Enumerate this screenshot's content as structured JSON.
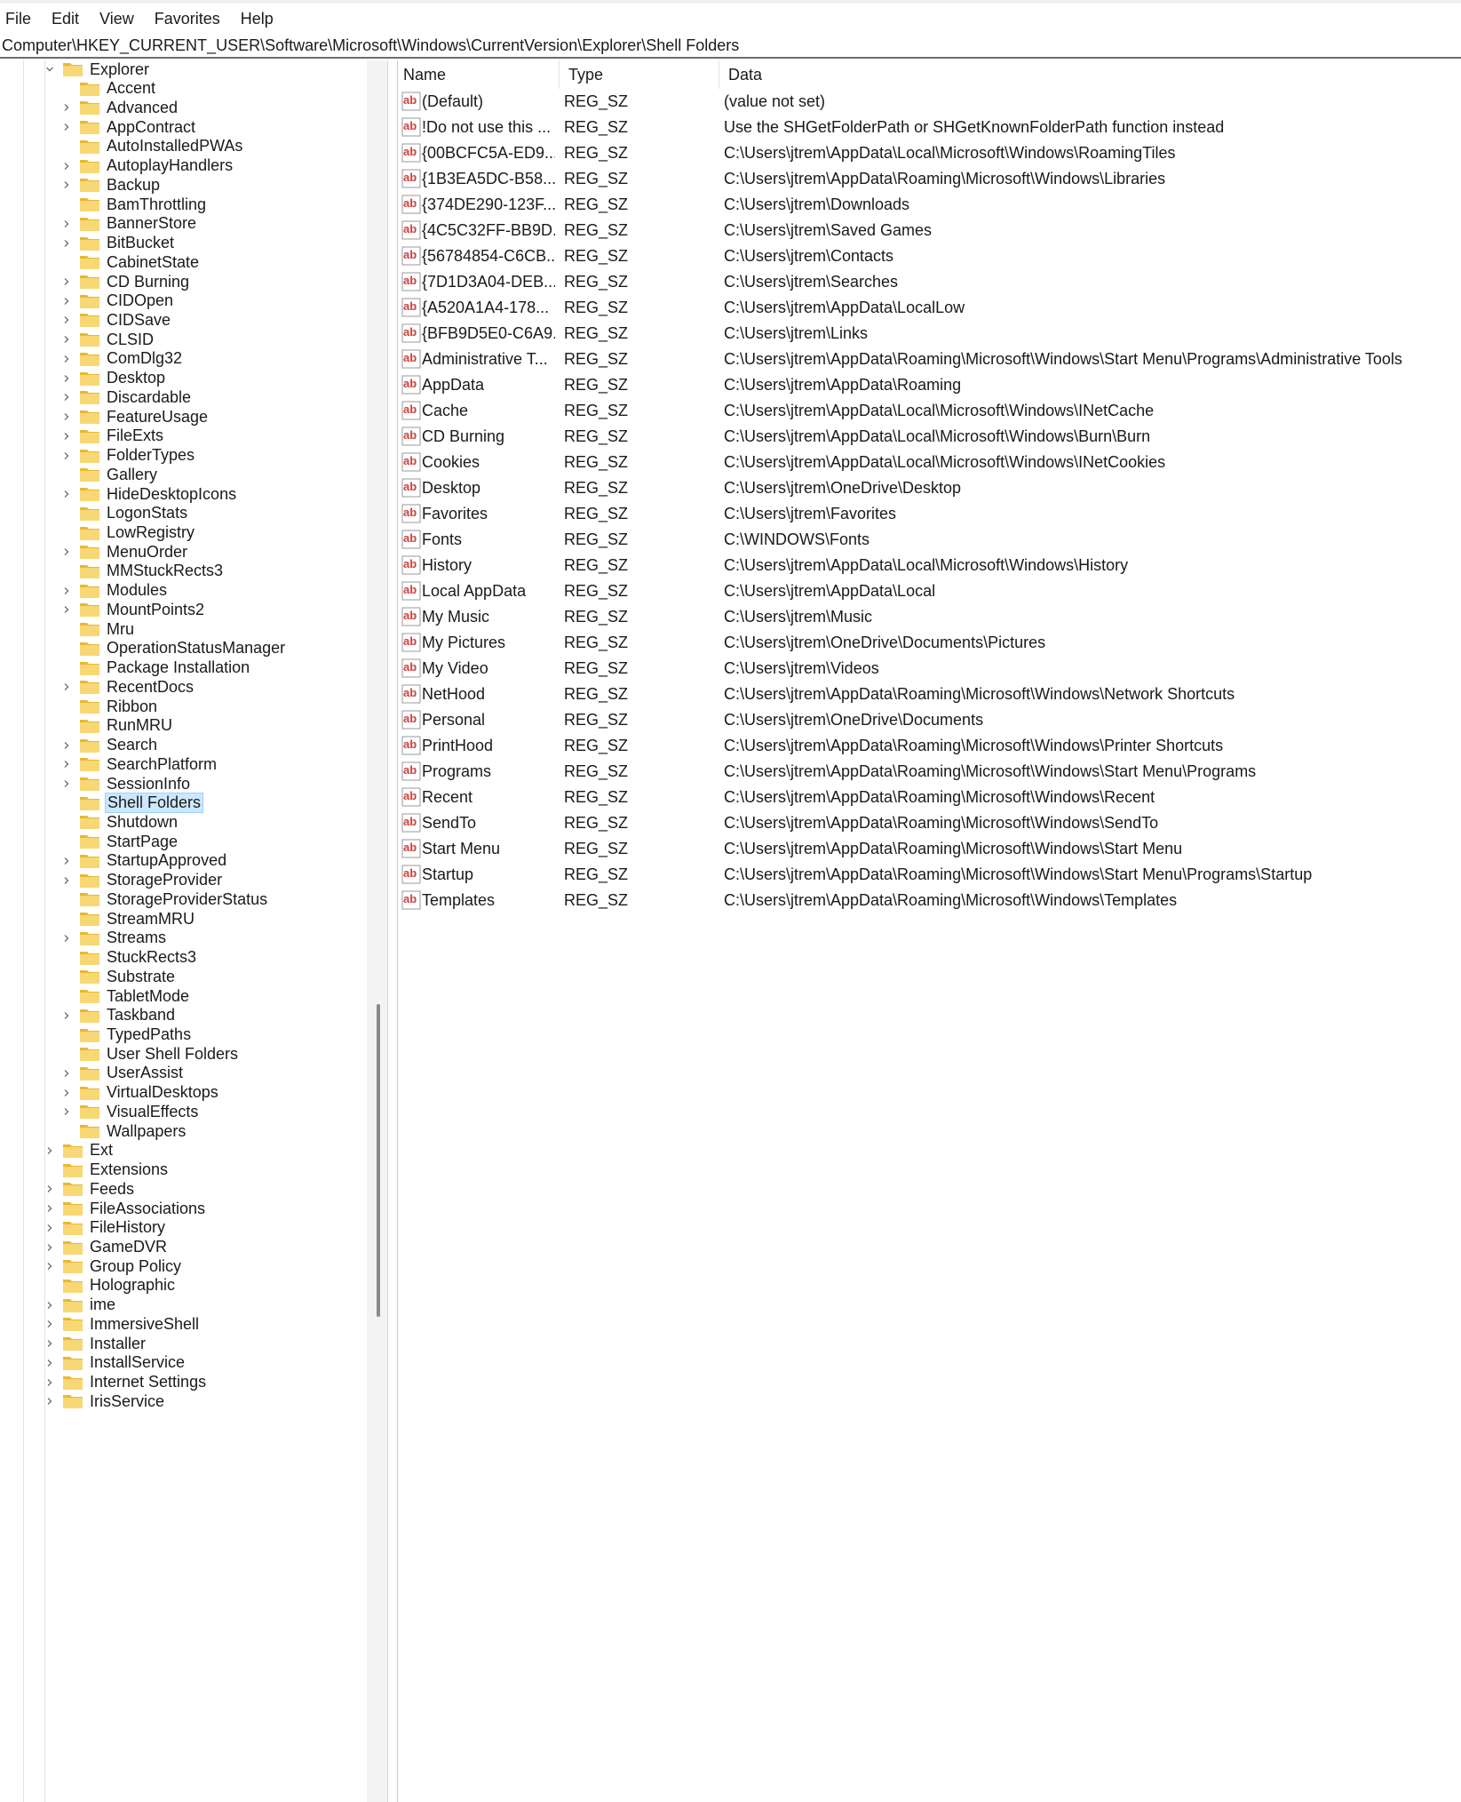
{
  "menu": [
    "File",
    "Edit",
    "View",
    "Favorites",
    "Help"
  ],
  "address": "Computer\\HKEY_CURRENT_USER\\Software\\Microsoft\\Windows\\CurrentVersion\\Explorer\\Shell Folders",
  "tree": {
    "parent": "Explorer",
    "children": [
      {
        "label": "Accent",
        "expandable": false
      },
      {
        "label": "Advanced",
        "expandable": true
      },
      {
        "label": "AppContract",
        "expandable": true
      },
      {
        "label": "AutoInstalledPWAs",
        "expandable": false
      },
      {
        "label": "AutoplayHandlers",
        "expandable": true
      },
      {
        "label": "Backup",
        "expandable": true
      },
      {
        "label": "BamThrottling",
        "expandable": false
      },
      {
        "label": "BannerStore",
        "expandable": true
      },
      {
        "label": "BitBucket",
        "expandable": true
      },
      {
        "label": "CabinetState",
        "expandable": false
      },
      {
        "label": "CD Burning",
        "expandable": true
      },
      {
        "label": "CIDOpen",
        "expandable": true
      },
      {
        "label": "CIDSave",
        "expandable": true
      },
      {
        "label": "CLSID",
        "expandable": true
      },
      {
        "label": "ComDlg32",
        "expandable": true
      },
      {
        "label": "Desktop",
        "expandable": true
      },
      {
        "label": "Discardable",
        "expandable": true
      },
      {
        "label": "FeatureUsage",
        "expandable": true
      },
      {
        "label": "FileExts",
        "expandable": true
      },
      {
        "label": "FolderTypes",
        "expandable": true
      },
      {
        "label": "Gallery",
        "expandable": false
      },
      {
        "label": "HideDesktopIcons",
        "expandable": true
      },
      {
        "label": "LogonStats",
        "expandable": false
      },
      {
        "label": "LowRegistry",
        "expandable": false
      },
      {
        "label": "MenuOrder",
        "expandable": true
      },
      {
        "label": "MMStuckRects3",
        "expandable": false
      },
      {
        "label": "Modules",
        "expandable": true
      },
      {
        "label": "MountPoints2",
        "expandable": true
      },
      {
        "label": "Mru",
        "expandable": false
      },
      {
        "label": "OperationStatusManager",
        "expandable": false
      },
      {
        "label": "Package Installation",
        "expandable": false
      },
      {
        "label": "RecentDocs",
        "expandable": true
      },
      {
        "label": "Ribbon",
        "expandable": false
      },
      {
        "label": "RunMRU",
        "expandable": false
      },
      {
        "label": "Search",
        "expandable": true
      },
      {
        "label": "SearchPlatform",
        "expandable": true
      },
      {
        "label": "SessionInfo",
        "expandable": true
      },
      {
        "label": "Shell Folders",
        "expandable": false,
        "selected": true
      },
      {
        "label": "Shutdown",
        "expandable": false
      },
      {
        "label": "StartPage",
        "expandable": false
      },
      {
        "label": "StartupApproved",
        "expandable": true
      },
      {
        "label": "StorageProvider",
        "expandable": true
      },
      {
        "label": "StorageProviderStatus",
        "expandable": false
      },
      {
        "label": "StreamMRU",
        "expandable": false
      },
      {
        "label": "Streams",
        "expandable": true
      },
      {
        "label": "StuckRects3",
        "expandable": false
      },
      {
        "label": "Substrate",
        "expandable": false
      },
      {
        "label": "TabletMode",
        "expandable": false
      },
      {
        "label": "Taskband",
        "expandable": true
      },
      {
        "label": "TypedPaths",
        "expandable": false
      },
      {
        "label": "User Shell Folders",
        "expandable": false
      },
      {
        "label": "UserAssist",
        "expandable": true
      },
      {
        "label": "VirtualDesktops",
        "expandable": true
      },
      {
        "label": "VisualEffects",
        "expandable": true
      },
      {
        "label": "Wallpapers",
        "expandable": false
      }
    ],
    "siblings": [
      {
        "label": "Ext",
        "expandable": true
      },
      {
        "label": "Extensions",
        "expandable": false
      },
      {
        "label": "Feeds",
        "expandable": true
      },
      {
        "label": "FileAssociations",
        "expandable": true
      },
      {
        "label": "FileHistory",
        "expandable": true
      },
      {
        "label": "GameDVR",
        "expandable": true
      },
      {
        "label": "Group Policy",
        "expandable": true
      },
      {
        "label": "Holographic",
        "expandable": false
      },
      {
        "label": "ime",
        "expandable": true
      },
      {
        "label": "ImmersiveShell",
        "expandable": true
      },
      {
        "label": "Installer",
        "expandable": true
      },
      {
        "label": "InstallService",
        "expandable": true
      },
      {
        "label": "Internet Settings",
        "expandable": true
      },
      {
        "label": "IrisService",
        "expandable": true
      }
    ]
  },
  "columns": {
    "name": "Name",
    "type": "Type",
    "data": "Data"
  },
  "values": [
    {
      "name": "(Default)",
      "type": "REG_SZ",
      "data": "(value not set)"
    },
    {
      "name": "!Do not use this ...",
      "type": "REG_SZ",
      "data": "Use the SHGetFolderPath or SHGetKnownFolderPath function instead"
    },
    {
      "name": "{00BCFC5A-ED9...",
      "type": "REG_SZ",
      "data": "C:\\Users\\jtrem\\AppData\\Local\\Microsoft\\Windows\\RoamingTiles"
    },
    {
      "name": "{1B3EA5DC-B58...",
      "type": "REG_SZ",
      "data": "C:\\Users\\jtrem\\AppData\\Roaming\\Microsoft\\Windows\\Libraries"
    },
    {
      "name": "{374DE290-123F...",
      "type": "REG_SZ",
      "data": "C:\\Users\\jtrem\\Downloads"
    },
    {
      "name": "{4C5C32FF-BB9D...",
      "type": "REG_SZ",
      "data": "C:\\Users\\jtrem\\Saved Games"
    },
    {
      "name": "{56784854-C6CB...",
      "type": "REG_SZ",
      "data": "C:\\Users\\jtrem\\Contacts"
    },
    {
      "name": "{7D1D3A04-DEB...",
      "type": "REG_SZ",
      "data": "C:\\Users\\jtrem\\Searches"
    },
    {
      "name": "{A520A1A4-178...",
      "type": "REG_SZ",
      "data": "C:\\Users\\jtrem\\AppData\\LocalLow"
    },
    {
      "name": "{BFB9D5E0-C6A9...",
      "type": "REG_SZ",
      "data": "C:\\Users\\jtrem\\Links"
    },
    {
      "name": "Administrative T...",
      "type": "REG_SZ",
      "data": "C:\\Users\\jtrem\\AppData\\Roaming\\Microsoft\\Windows\\Start Menu\\Programs\\Administrative Tools"
    },
    {
      "name": "AppData",
      "type": "REG_SZ",
      "data": "C:\\Users\\jtrem\\AppData\\Roaming"
    },
    {
      "name": "Cache",
      "type": "REG_SZ",
      "data": "C:\\Users\\jtrem\\AppData\\Local\\Microsoft\\Windows\\INetCache"
    },
    {
      "name": "CD Burning",
      "type": "REG_SZ",
      "data": "C:\\Users\\jtrem\\AppData\\Local\\Microsoft\\Windows\\Burn\\Burn"
    },
    {
      "name": "Cookies",
      "type": "REG_SZ",
      "data": "C:\\Users\\jtrem\\AppData\\Local\\Microsoft\\Windows\\INetCookies"
    },
    {
      "name": "Desktop",
      "type": "REG_SZ",
      "data": "C:\\Users\\jtrem\\OneDrive\\Desktop"
    },
    {
      "name": "Favorites",
      "type": "REG_SZ",
      "data": "C:\\Users\\jtrem\\Favorites"
    },
    {
      "name": "Fonts",
      "type": "REG_SZ",
      "data": "C:\\WINDOWS\\Fonts"
    },
    {
      "name": "History",
      "type": "REG_SZ",
      "data": "C:\\Users\\jtrem\\AppData\\Local\\Microsoft\\Windows\\History"
    },
    {
      "name": "Local AppData",
      "type": "REG_SZ",
      "data": "C:\\Users\\jtrem\\AppData\\Local"
    },
    {
      "name": "My Music",
      "type": "REG_SZ",
      "data": "C:\\Users\\jtrem\\Music"
    },
    {
      "name": "My Pictures",
      "type": "REG_SZ",
      "data": "C:\\Users\\jtrem\\OneDrive\\Documents\\Pictures"
    },
    {
      "name": "My Video",
      "type": "REG_SZ",
      "data": "C:\\Users\\jtrem\\Videos"
    },
    {
      "name": "NetHood",
      "type": "REG_SZ",
      "data": "C:\\Users\\jtrem\\AppData\\Roaming\\Microsoft\\Windows\\Network Shortcuts"
    },
    {
      "name": "Personal",
      "type": "REG_SZ",
      "data": "C:\\Users\\jtrem\\OneDrive\\Documents"
    },
    {
      "name": "PrintHood",
      "type": "REG_SZ",
      "data": "C:\\Users\\jtrem\\AppData\\Roaming\\Microsoft\\Windows\\Printer Shortcuts"
    },
    {
      "name": "Programs",
      "type": "REG_SZ",
      "data": "C:\\Users\\jtrem\\AppData\\Roaming\\Microsoft\\Windows\\Start Menu\\Programs"
    },
    {
      "name": "Recent",
      "type": "REG_SZ",
      "data": "C:\\Users\\jtrem\\AppData\\Roaming\\Microsoft\\Windows\\Recent"
    },
    {
      "name": "SendTo",
      "type": "REG_SZ",
      "data": "C:\\Users\\jtrem\\AppData\\Roaming\\Microsoft\\Windows\\SendTo"
    },
    {
      "name": "Start Menu",
      "type": "REG_SZ",
      "data": "C:\\Users\\jtrem\\AppData\\Roaming\\Microsoft\\Windows\\Start Menu"
    },
    {
      "name": "Startup",
      "type": "REG_SZ",
      "data": "C:\\Users\\jtrem\\AppData\\Roaming\\Microsoft\\Windows\\Start Menu\\Programs\\Startup"
    },
    {
      "name": "Templates",
      "type": "REG_SZ",
      "data": "C:\\Users\\jtrem\\AppData\\Roaming\\Microsoft\\Windows\\Templates"
    }
  ],
  "icons": {
    "folder": "folder-icon",
    "string_value": "reg-sz-icon",
    "expand": "chevron-right-icon",
    "collapse": "chevron-down-icon"
  },
  "colors": {
    "folder": "#f8d775",
    "folder_dark": "#e8b830",
    "selection": "#cce8ff",
    "selection_border": "#99d1ff",
    "value_icon": "#d04040"
  }
}
